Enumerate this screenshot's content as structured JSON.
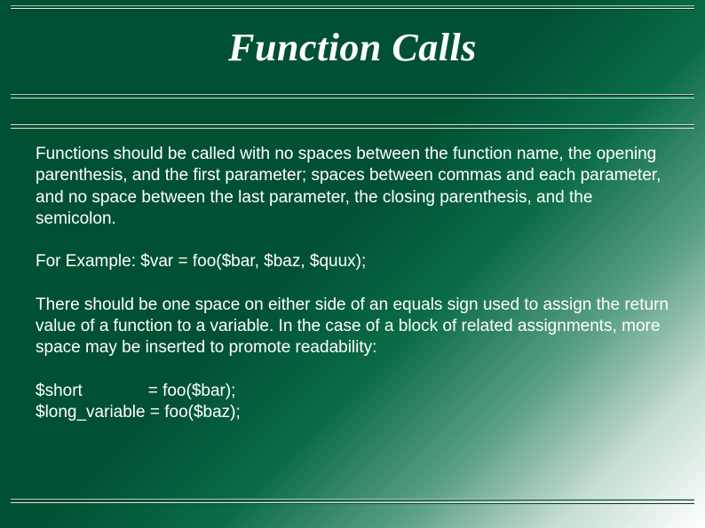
{
  "title": "Function Calls",
  "paragraphs": {
    "p1": "Functions should be called with no spaces between the function name, the opening parenthesis, and the first parameter; spaces between commas and each parameter, and no space between the last parameter, the closing parenthesis, and the semicolon.",
    "p2": "For Example: $var = foo($bar, $baz, $quux);",
    "p3": "There should be one space on either side of an equals sign used to assign the return value of a function to a variable. In the case of a block of related assignments, more space may be inserted to promote readability:",
    "code": "$short              = foo($bar);\n$long_variable = foo($baz);"
  }
}
